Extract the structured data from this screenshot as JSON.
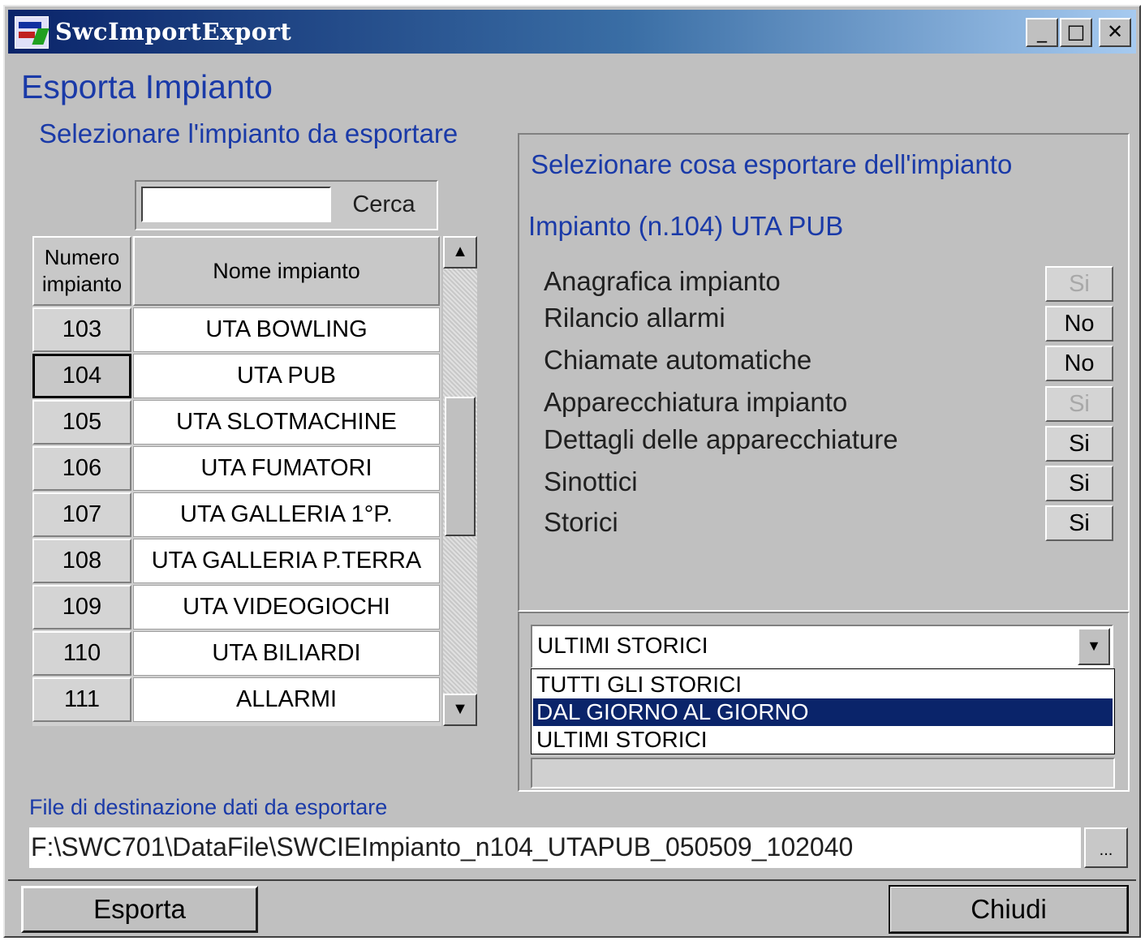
{
  "window": {
    "title": "SwcImportExport",
    "controls": [
      "_",
      "□",
      "✕"
    ]
  },
  "page_title": "Esporta Impianto",
  "left": {
    "heading": "Selezionare l'impianto da esportare",
    "search": {
      "value": "",
      "button_label": "Cerca"
    },
    "table": {
      "headers": {
        "number": "Numero\nimpianto",
        "name": "Nome impianto"
      },
      "rows": [
        {
          "number": "103",
          "name": "UTA BOWLING"
        },
        {
          "number": "104",
          "name": "UTA PUB"
        },
        {
          "number": "105",
          "name": "UTA SLOTMACHINE"
        },
        {
          "number": "106",
          "name": "UTA FUMATORI"
        },
        {
          "number": "107",
          "name": "UTA GALLERIA 1°P."
        },
        {
          "number": "108",
          "name": "UTA GALLERIA P.TERRA"
        },
        {
          "number": "109",
          "name": "UTA VIDEOGIOCHI"
        },
        {
          "number": "110",
          "name": "UTA BILIARDI"
        },
        {
          "number": "111",
          "name": "ALLARMI"
        }
      ],
      "selected_number": "104"
    }
  },
  "right": {
    "heading": "Selezionare cosa esportare dell'impianto",
    "selected_plant": "Impianto (n.104) UTA PUB",
    "options": [
      {
        "label": "Anagrafica impianto",
        "value": "Si",
        "enabled": false
      },
      {
        "label": "Rilancio allarmi",
        "value": "No",
        "enabled": true
      },
      {
        "label": "Chiamate automatiche",
        "value": "No",
        "enabled": true
      },
      {
        "label": "Apparecchiatura impianto",
        "value": "Si",
        "enabled": false
      },
      {
        "label": "Dettagli delle apparecchiature",
        "value": "Si",
        "enabled": true
      },
      {
        "label": "Sinottici",
        "value": "Si",
        "enabled": true
      },
      {
        "label": "Storici",
        "value": "Si",
        "enabled": true
      }
    ],
    "history_select": {
      "value": "ULTIMI STORICI",
      "options": [
        "TUTTI GLI STORICI",
        "DAL GIORNO AL GIORNO",
        "ULTIMI STORICI"
      ],
      "highlighted": "DAL GIORNO AL GIORNO"
    }
  },
  "destination": {
    "label": "File di destinazione dati da esportare",
    "path": "F:\\SWC701\\DataFile\\SWCIEImpianto_n104_UTAPUB_050509_102040",
    "browse_label": "..."
  },
  "buttons": {
    "export": "Esporta",
    "close": "Chiudi"
  },
  "colors": {
    "accent_text": "#1a3aa8",
    "selection": "#0a246a",
    "face": "#c0c0c0"
  }
}
